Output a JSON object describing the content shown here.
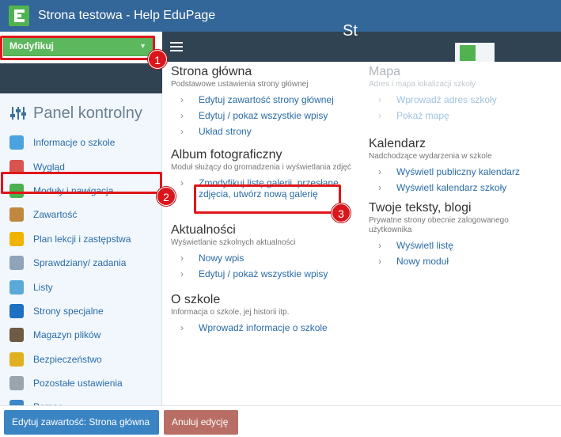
{
  "app": {
    "title": "Strona testowa - Help EduPage"
  },
  "left": {
    "modify_label": "Modyfikuj",
    "panel_title": "Panel kontrolny",
    "items": [
      {
        "label": "Informacje o szkole",
        "icon": "globe-icon",
        "color": "#4aa3df"
      },
      {
        "label": "Wygląd",
        "icon": "palette-icon",
        "color": "#d9534f"
      },
      {
        "label": "Moduły i nawigacja",
        "icon": "modules-icon",
        "color": "#4caf50"
      },
      {
        "label": "Zawartość",
        "icon": "content-icon",
        "color": "#c2873f"
      },
      {
        "label": "Plan lekcji i zastępstwa",
        "icon": "bell-icon",
        "color": "#f0b400"
      },
      {
        "label": "Sprawdziany/ zadania",
        "icon": "notebook-icon",
        "color": "#8fa4b8"
      },
      {
        "label": "Listy",
        "icon": "list-icon",
        "color": "#5aa9d8"
      },
      {
        "label": "Strony specjalne",
        "icon": "cube-icon",
        "color": "#1f6fc2"
      },
      {
        "label": "Magazyn plików",
        "icon": "files-icon",
        "color": "#6e5a45"
      },
      {
        "label": "Bezpieczeństwo",
        "icon": "shield-icon",
        "color": "#e0b020"
      },
      {
        "label": "Pozostałe ustawienia",
        "icon": "gear-icon",
        "color": "#9aa5ad"
      },
      {
        "label": "Pomoc",
        "icon": "help-icon",
        "color": "#3f87c9"
      }
    ]
  },
  "menu": {
    "col1": [
      {
        "title": "Strona główna",
        "subtitle": "Podstawowe ustawienia strony głównej",
        "links": [
          "Edytuj zawartość strony głównej",
          "Edytuj / pokaż wszystkie wpisy",
          "Układ strony"
        ]
      },
      {
        "title": "Album fotograficzny",
        "subtitle": "Moduł służący do gromadzenia i wyświetlania zdjęć",
        "links": [
          "Zmodyfikuj listę galerii, przesłane zdjęcia, utwórz nową galerię"
        ]
      },
      {
        "title": "Aktualności",
        "subtitle": "Wyświetlanie szkolnych aktualności",
        "links": [
          "Nowy wpis",
          "Edytuj / pokaż wszystkie wpisy"
        ]
      },
      {
        "title": "O szkole",
        "subtitle": "Informacja o szkole, jej historii itp.",
        "links": [
          "Wprowadź informacje o szkole"
        ]
      }
    ],
    "col2": [
      {
        "title": "Mapa",
        "subtitle": "Adres i mapa lokalizacji szkoły",
        "links": [
          "Wprowadź adres szkoły",
          "Pokaż mapę"
        ]
      },
      {
        "title": "Kalendarz",
        "subtitle": "Nadchodzące wydarzenia w szkole",
        "links": [
          "Wyświetl publiczny kalendarz",
          "Wyświetl kalendarz szkoły"
        ]
      },
      {
        "title": "Twoje teksty, blogi",
        "subtitle": "Prywatne strony obecnie zalogowanego użytkownika",
        "links": [
          "Wyświetl listę",
          "Nowy moduł"
        ]
      }
    ]
  },
  "header_right_text": "St",
  "badges": [
    "1",
    "2",
    "3"
  ],
  "footer": {
    "edit_label": "Edytuj zawartość: Strona główna",
    "cancel_label": "Anuluj edycję"
  }
}
